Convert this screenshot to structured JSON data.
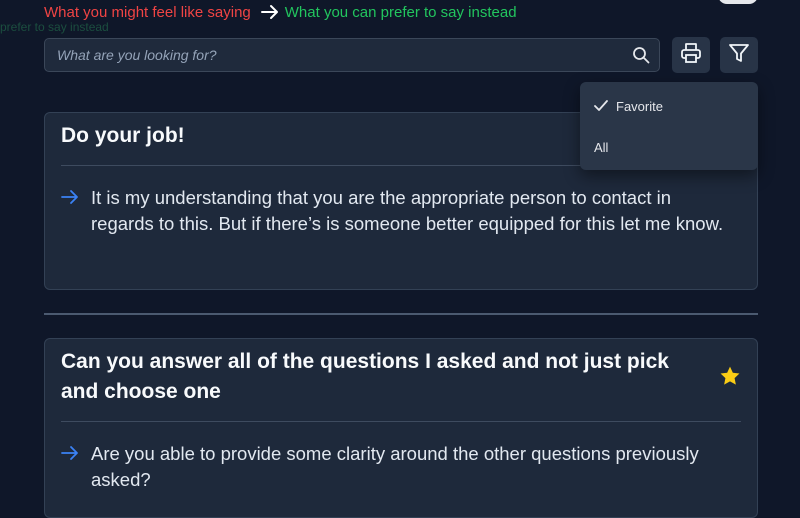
{
  "legend": {
    "feel_label": "What you might feel like saying",
    "prefer_label": "What you can prefer to say instead",
    "ghost_text": "prefer to say instead"
  },
  "search": {
    "placeholder": "What are you looking for?"
  },
  "filter_menu": {
    "options": [
      {
        "label": "Favorite",
        "selected": true
      },
      {
        "label": "All",
        "selected": false
      }
    ]
  },
  "cards": [
    {
      "title": "Do your job!",
      "favorite": false,
      "alternative": "It is my understanding that you are the appropriate person to contact in regards to this. But if there’s is someone better equipped for this let me know."
    },
    {
      "title": "Can you answer all of the questions I asked and not just pick and choose one",
      "favorite": true,
      "alternative": "Are you able to provide some clarity around the other questions previously asked?"
    }
  ],
  "colors": {
    "background": "#0f1729",
    "card": "#1e293b",
    "feel_red": "#ef4444",
    "prefer_green": "#22c55e",
    "arrow_blue": "#3b82f6",
    "star_yellow": "#facc15"
  },
  "icons": [
    "arrow-right-icon",
    "search-icon",
    "printer-icon",
    "filter-icon",
    "check-icon",
    "star-icon"
  ]
}
